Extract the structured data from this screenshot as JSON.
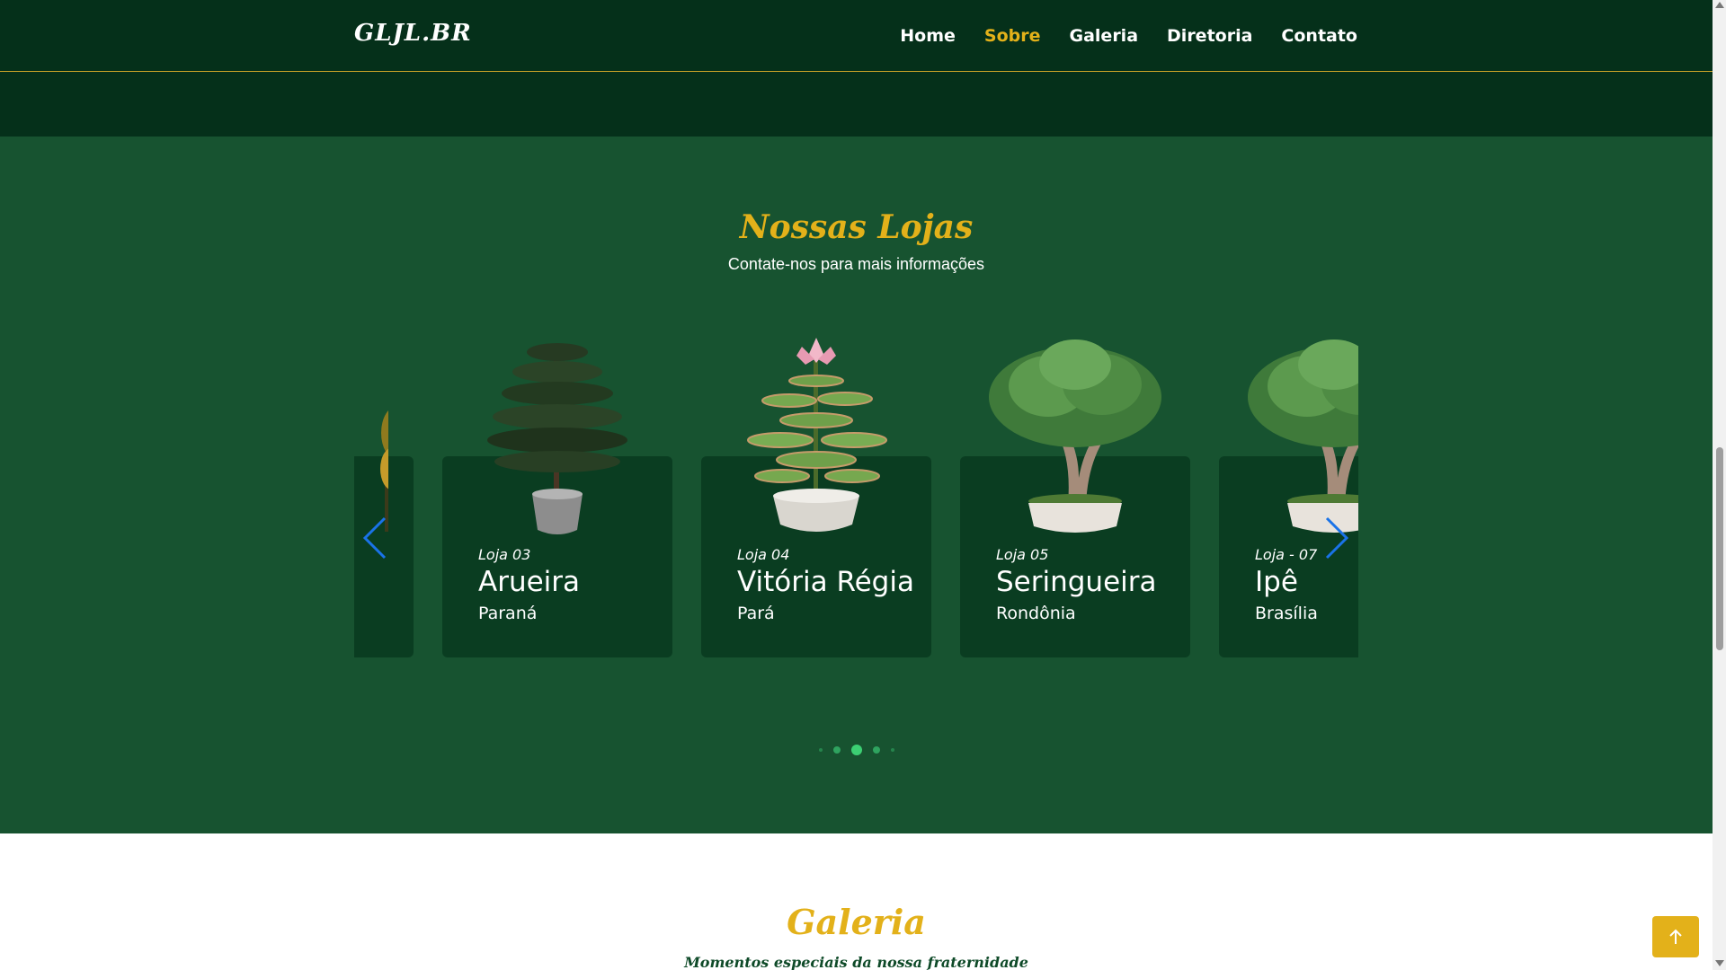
{
  "header": {
    "brand": "GLJL.BR",
    "nav": [
      {
        "label": "Home",
        "active": false
      },
      {
        "label": "Sobre",
        "active": true
      },
      {
        "label": "Galeria",
        "active": false
      },
      {
        "label": "Diretoria",
        "active": false
      },
      {
        "label": "Contato",
        "active": false
      }
    ]
  },
  "stores": {
    "title": "Nossas Lojas",
    "subtitle": "Contate-nos para mais informações",
    "cards": [
      {
        "loja": "",
        "name": "",
        "state": "",
        "icon": "golden-plant-icon"
      },
      {
        "loja": "Loja 03",
        "name": "Arueira",
        "state": "Paraná",
        "icon": "araucaria-tree-icon"
      },
      {
        "loja": "Loja 04",
        "name": "Vitória Régia",
        "state": "Pará",
        "icon": "water-lily-icon"
      },
      {
        "loja": "Loja 05",
        "name": "Seringueira",
        "state": "Rondônia",
        "icon": "bonsai-tree-icon"
      },
      {
        "loja": "Loja - 07",
        "name": "Ipê",
        "state": "Brasília",
        "icon": "bonsai-tree-icon"
      }
    ],
    "pagination": {
      "count": 5,
      "active_index": 2
    }
  },
  "gallery": {
    "title": "Galeria",
    "subtitle": "Momentos especiais da nossa fraternidade"
  },
  "colors": {
    "header_bg": "#05301a",
    "section_bg": "#175330",
    "card_bg": "#0a3d21",
    "accent": "#e3b11a",
    "arrow": "#1a73e8"
  }
}
